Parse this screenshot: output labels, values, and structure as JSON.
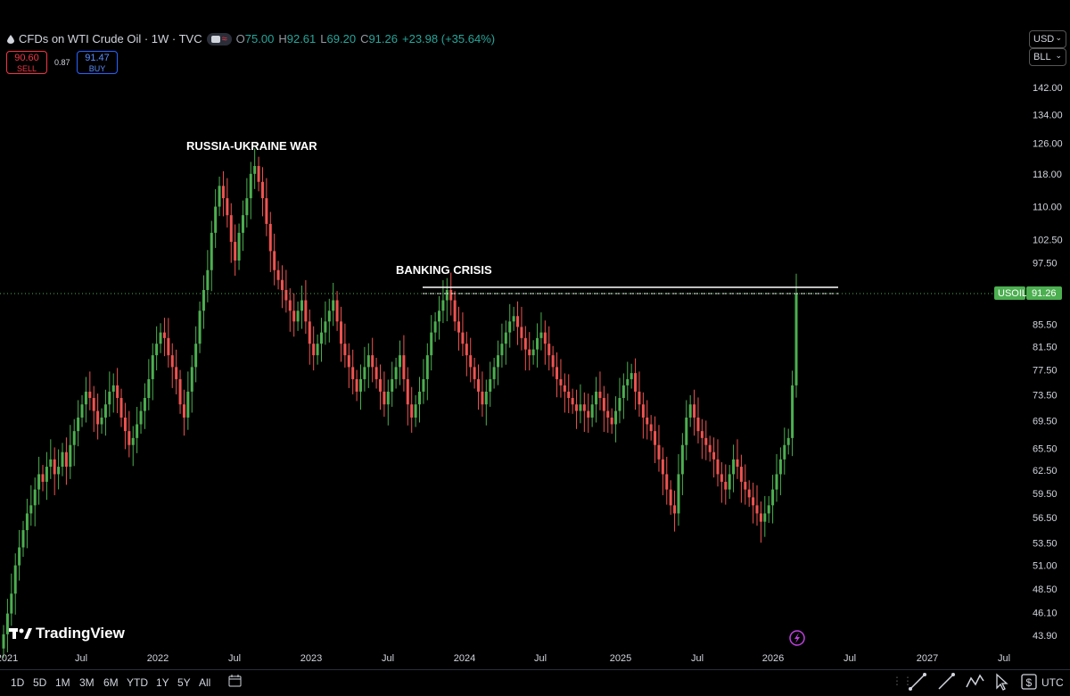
{
  "header": {
    "symbol_title": "CFDs on WTI Crude Oil · 1W · TVC",
    "open_key": "O",
    "open": "75.00",
    "high_key": "H",
    "high": "92.61",
    "low_key": "L",
    "low": "69.20",
    "close_key": "C",
    "close": "91.26",
    "change": "+23.98 (+35.64%)"
  },
  "trade": {
    "sell_price": "90.60",
    "sell_label": "SELL",
    "spread": "0.87",
    "buy_price": "91.47",
    "buy_label": "BUY"
  },
  "currency": {
    "value": "USD",
    "unit": "BLL"
  },
  "price_axis": {
    "labels": [
      "142.00",
      "134.00",
      "126.00",
      "118.00",
      "110.00",
      "102.50",
      "97.50",
      "85.50",
      "81.50",
      "77.50",
      "73.50",
      "69.50",
      "65.50",
      "62.50",
      "59.50",
      "56.50",
      "53.50",
      "51.00",
      "48.50",
      "46.10",
      "43.90"
    ],
    "values": [
      142,
      134,
      126,
      118,
      110,
      102.5,
      97.5,
      85.5,
      81.5,
      77.5,
      73.5,
      69.5,
      65.5,
      62.5,
      59.5,
      56.5,
      53.5,
      51,
      48.5,
      46.1,
      43.9
    ]
  },
  "current_price": {
    "symbol": "USOIL",
    "value": "91.26"
  },
  "time_axis": {
    "labels": [
      "2021",
      "Jul",
      "2022",
      "Jul",
      "2023",
      "Jul",
      "2024",
      "Jul",
      "2025",
      "Jul",
      "2026",
      "Jul",
      "2027",
      "Jul"
    ]
  },
  "annotations": {
    "war": "RUSSIA-UKRAINE WAR",
    "banking": "BANKING CRISIS"
  },
  "brand": "TradingView",
  "timeframes": [
    "1D",
    "5D",
    "1M",
    "3M",
    "6M",
    "YTD",
    "1Y",
    "5Y",
    "All"
  ],
  "tools": [
    "trendline-icon",
    "ray-icon",
    "indicator-icon",
    "long-short-icon",
    "cursor-icon",
    "price-range-icon"
  ],
  "timezone": "UTC",
  "colors": {
    "up": "#26a69a",
    "down": "#f23645",
    "up_bright": "#4caf50",
    "down_bright": "#ef5350",
    "level_line": "#ffffff"
  },
  "chart_data": {
    "type": "candlestick",
    "title": "CFDs on WTI Crude Oil · 1W · TVC",
    "y_scale": "log",
    "ylim": [
      43.9,
      142
    ],
    "x_range": [
      "2021",
      "Jul 2027"
    ],
    "closes": [
      44,
      46,
      48,
      51,
      53,
      55,
      57,
      58,
      60,
      62,
      61,
      63,
      64,
      62,
      63,
      65,
      63,
      66,
      68,
      70,
      72,
      74,
      73,
      71,
      69,
      70,
      72,
      74,
      75,
      73,
      70,
      68,
      66,
      67,
      69,
      71,
      73,
      76,
      80,
      82,
      84,
      83,
      80,
      78,
      76,
      72,
      70,
      74,
      78,
      82,
      88,
      92,
      96,
      104,
      110,
      115,
      112,
      108,
      102,
      98,
      104,
      108,
      112,
      118,
      120,
      116,
      112,
      106,
      100,
      96,
      94,
      92,
      90,
      88,
      86,
      88,
      90,
      86,
      82,
      80,
      82,
      84,
      86,
      88,
      90,
      86,
      82,
      80,
      78,
      76,
      74,
      76,
      78,
      80,
      78,
      76,
      74,
      72,
      74,
      76,
      78,
      80,
      76,
      72,
      70,
      72,
      74,
      76,
      80,
      84,
      86,
      88,
      90,
      92,
      90,
      86,
      84,
      82,
      80,
      78,
      76,
      74,
      72,
      74,
      76,
      78,
      80,
      82,
      84,
      86,
      87,
      85,
      83,
      81,
      80,
      81,
      83,
      84,
      82,
      80,
      78,
      76,
      75,
      74,
      73,
      72,
      71,
      72,
      71,
      70,
      72,
      74,
      73,
      71,
      70,
      69,
      71,
      73,
      75,
      76,
      77,
      74,
      72,
      70,
      69,
      68,
      66,
      64,
      62,
      60,
      58,
      57,
      62,
      66,
      70,
      72,
      70,
      68,
      67,
      66,
      65,
      64,
      62,
      61,
      60,
      62,
      64,
      63,
      61,
      60,
      59,
      58,
      57,
      56,
      57,
      58,
      60,
      62,
      64,
      66,
      67,
      75,
      91.26
    ]
  }
}
